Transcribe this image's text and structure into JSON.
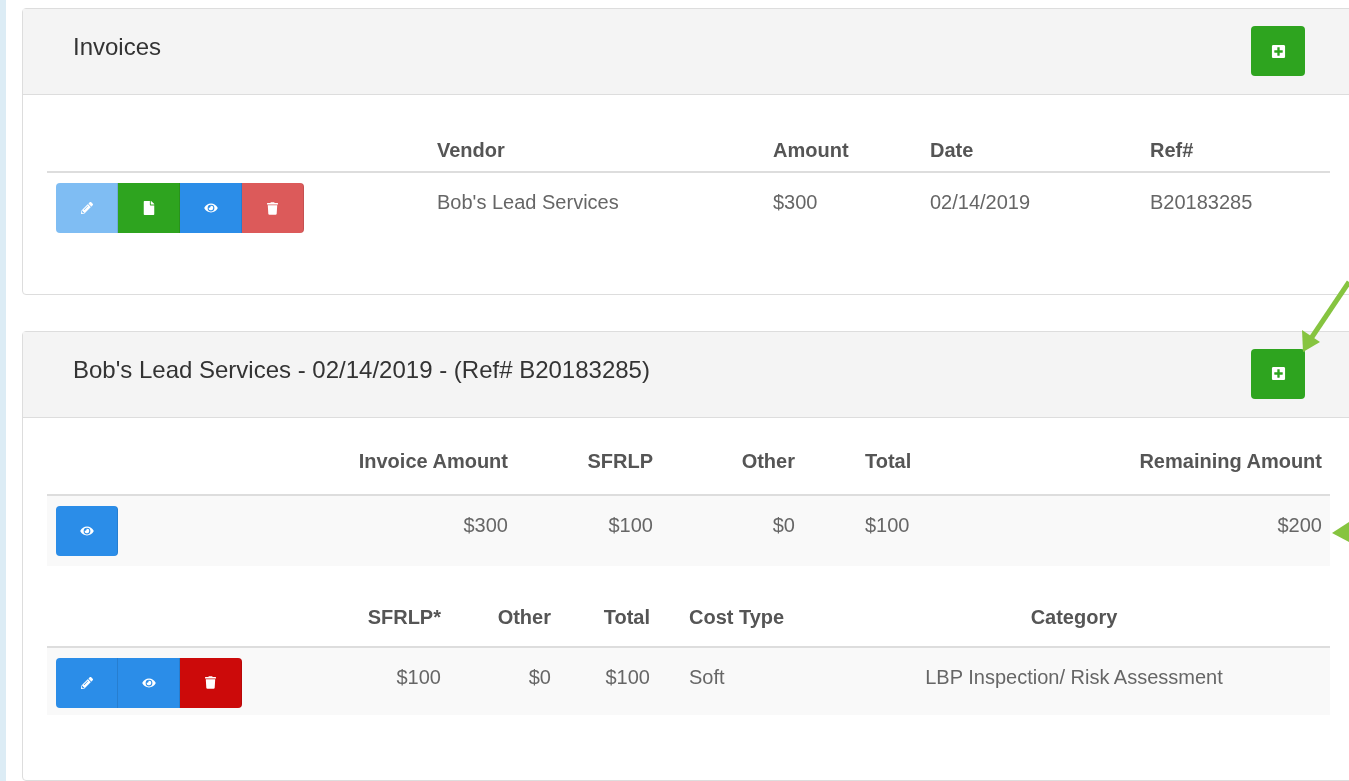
{
  "panels": [
    {
      "title": "Invoices",
      "tables": [
        {
          "columns": [
            "Vendor",
            "Amount",
            "Date",
            "Ref#"
          ],
          "rows": [
            {
              "actions": [
                {
                  "kind": "edit",
                  "disabled": true
                },
                {
                  "kind": "file",
                  "disabled": false
                },
                {
                  "kind": "view",
                  "disabled": false
                },
                {
                  "kind": "delete",
                  "disabled": true
                }
              ],
              "cells": [
                "Bob's Lead Services",
                "$300",
                "02/14/2019",
                "B20183285"
              ]
            }
          ]
        }
      ]
    },
    {
      "title": "Bob's Lead Services - 02/14/2019 - (Ref# B20183285)",
      "tables": [
        {
          "columns": [
            "Invoice Amount",
            "SFRLP",
            "Other",
            "Total",
            "Remaining Amount"
          ],
          "rows": [
            {
              "actions": [
                {
                  "kind": "view",
                  "disabled": false
                }
              ],
              "cells": [
                "$300",
                "$100",
                "$0",
                "$100",
                "$200"
              ]
            }
          ]
        },
        {
          "columns": [
            "SFRLP*",
            "Other",
            "Total",
            "Cost Type",
            "Category"
          ],
          "rows": [
            {
              "actions": [
                {
                  "kind": "edit",
                  "disabled": false
                },
                {
                  "kind": "view",
                  "disabled": false
                },
                {
                  "kind": "delete",
                  "disabled": false
                }
              ],
              "cells": [
                "$100",
                "$0",
                "$100",
                "Soft",
                "LBP Inspection/ Risk Assessment"
              ]
            }
          ]
        }
      ]
    }
  ]
}
